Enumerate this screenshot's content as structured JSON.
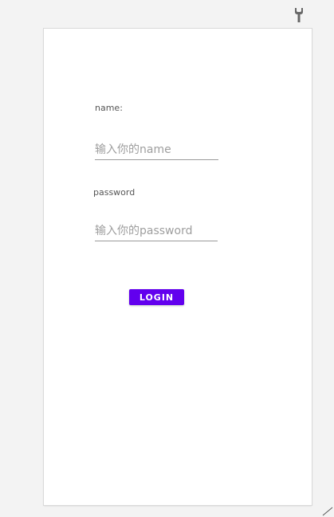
{
  "form": {
    "name_label": "name:",
    "name_placeholder": "输入你的name",
    "password_label": "password",
    "password_placeholder": "输入你的password",
    "login_label": "LOGIN"
  },
  "toolbar": {
    "icon": "wrench-icon"
  },
  "colors": {
    "accent": "#6200ee",
    "background": "#f3f3f3",
    "surface": "#ffffff"
  }
}
